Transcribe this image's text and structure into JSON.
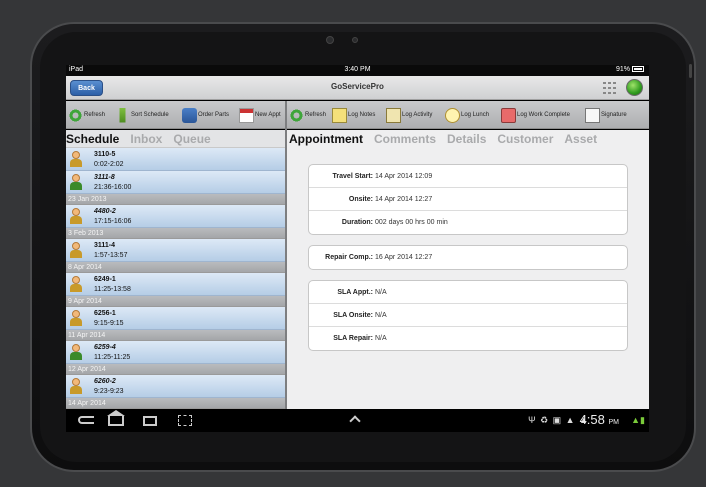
{
  "ios_status": {
    "device": "iPad",
    "time": "3:40 PM",
    "battery": "91%"
  },
  "titlebar": {
    "back_label": "Back",
    "title": "GoServicePro"
  },
  "toolbar_left": [
    {
      "label": "Refresh",
      "icon": "refresh-icon"
    },
    {
      "label": "Sort Schedule",
      "icon": "sort-icon"
    },
    {
      "label": "Order Parts",
      "icon": "cart-icon"
    },
    {
      "label": "New Appt",
      "icon": "calendar-icon"
    }
  ],
  "toolbar_right": [
    {
      "label": "Refresh",
      "icon": "refresh-icon"
    },
    {
      "label": "Log Notes",
      "icon": "notes-icon"
    },
    {
      "label": "Log Activity",
      "icon": "activity-icon"
    },
    {
      "label": "Log Lunch",
      "icon": "lunch-icon"
    },
    {
      "label": "Log Work Complete",
      "icon": "complete-icon"
    },
    {
      "label": "Signature",
      "icon": "signature-icon"
    }
  ],
  "left_tabs": {
    "schedule": "Schedule",
    "inbox": "Inbox",
    "queue": "Queue"
  },
  "right_tabs": {
    "appointment": "Appointment",
    "comments": "Comments",
    "details": "Details",
    "customer": "Customer",
    "asset": "Asset"
  },
  "schedule": {
    "r1": {
      "code": "3110-5",
      "time": "0:02-2:02"
    },
    "r2": {
      "code": "3111-8",
      "time": "21:36-16:00"
    },
    "d1": "23 Jan 2013",
    "r3": {
      "code": "4480-2",
      "time": "17:15-16:06"
    },
    "d2": "3 Feb 2013",
    "r4": {
      "code": "3111-4",
      "time": "1:57-13:57"
    },
    "d3": "8 Apr 2014",
    "r5": {
      "code": "6249-1",
      "time": "11:25-13:58"
    },
    "d4": "9 Apr 2014",
    "r6": {
      "code": "6256-1",
      "time": "9:15-9:15"
    },
    "d5": "11 Apr 2014",
    "r7": {
      "code": "6259-4",
      "time": "11:25-11:25"
    },
    "d6": "12 Apr 2014",
    "r8": {
      "code": "6260-2",
      "time": "9:23-9:23"
    },
    "d7": "14 Apr 2014"
  },
  "appointment": {
    "travel_start": {
      "label": "Travel Start:",
      "value": "14 Apr 2014 12:09"
    },
    "onsite": {
      "label": "Onsite:",
      "value": "14 Apr 2014 12:27"
    },
    "duration": {
      "label": "Duration:",
      "value": "002 days 00 hrs 00 min"
    },
    "repair_comp": {
      "label": "Repair Comp.:",
      "value": "16 Apr 2014 12:27"
    },
    "sla_appt": {
      "label": "SLA Appt.:",
      "value": "N/A"
    },
    "sla_onsite": {
      "label": "SLA Onsite:",
      "value": "N/A"
    },
    "sla_repair": {
      "label": "SLA Repair:",
      "value": "N/A"
    }
  },
  "android_status": {
    "time": "4:58",
    "ampm": "PM"
  }
}
